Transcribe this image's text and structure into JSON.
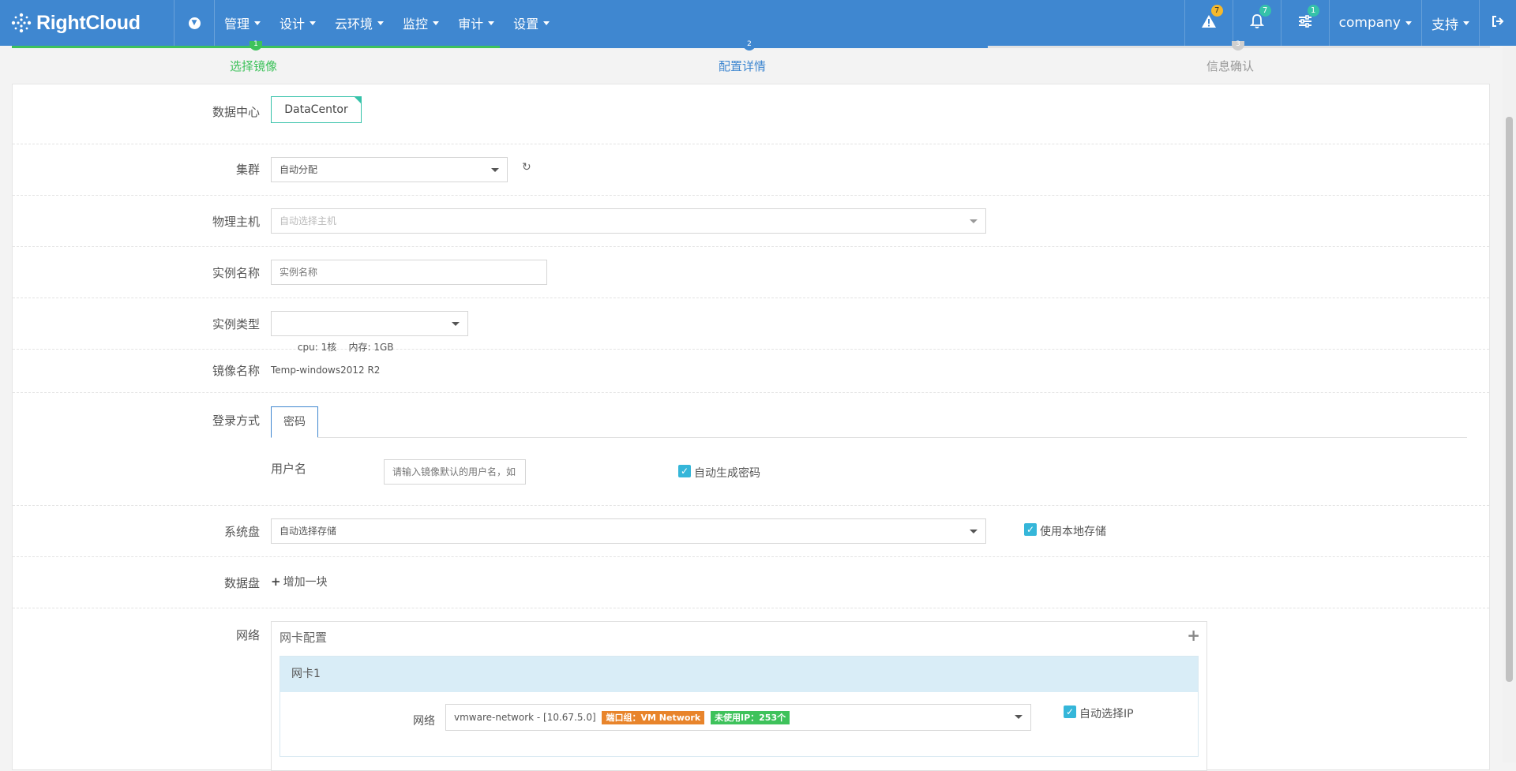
{
  "app": {
    "logo_text": "RightCloud"
  },
  "nav": {
    "menu": [
      {
        "label": "管理"
      },
      {
        "label": "设计"
      },
      {
        "label": "云环境"
      },
      {
        "label": "监控"
      },
      {
        "label": "审计"
      },
      {
        "label": "设置"
      }
    ],
    "alerts_count": "7",
    "notifications_count": "7",
    "settings_count": "1",
    "company": "company",
    "support": "支持"
  },
  "steps": [
    {
      "label": "选择镜像",
      "number": "1",
      "state": "done"
    },
    {
      "label": "配置详情",
      "number": "2",
      "state": "active"
    },
    {
      "label": "信息确认",
      "number": "3",
      "state": "pending"
    }
  ],
  "form": {
    "datacenter": {
      "label": "数据中心",
      "value": "DataCentor"
    },
    "cluster": {
      "label": "集群",
      "value": "自动分配"
    },
    "host": {
      "label": "物理主机",
      "placeholder": "自动选择主机"
    },
    "instance_name": {
      "label": "实例名称",
      "placeholder": "实例名称"
    },
    "instance_type": {
      "label": "实例类型",
      "value": "cpu: 1核    内存: 1GB"
    },
    "image": {
      "label": "镜像名称",
      "value": "Temp-windows2012 R2"
    },
    "login": {
      "label": "登录方式",
      "tab": "密码",
      "username_label": "用户名",
      "username_placeholder": "请输入镜像默认的用户名，如",
      "auto_password_label": "自动生成密码",
      "auto_password_checked": true
    },
    "system_disk": {
      "label": "系统盘",
      "value": "自动选择存储",
      "local_storage_label": "使用本地存储",
      "local_storage_checked": true
    },
    "data_disk": {
      "label": "数据盘",
      "add_label": "增加一块"
    },
    "network": {
      "label": "网络",
      "box_title": "网卡配置",
      "nic_title": "网卡1",
      "nic_network_label": "网络",
      "nic_value": "vmware-network - [10.67.5.0]",
      "port_group_tag": "端口组：VM Network",
      "unused_ip_tag": "未使用IP：253个",
      "auto_ip_label": "自动选择IP",
      "auto_ip_checked": true
    }
  },
  "colors": {
    "nav": "#3f87d0",
    "accent_teal": "#35c2a9",
    "step_done": "#3ec25b",
    "tag_orange": "#e8842b",
    "tag_green": "#3ec25b"
  }
}
